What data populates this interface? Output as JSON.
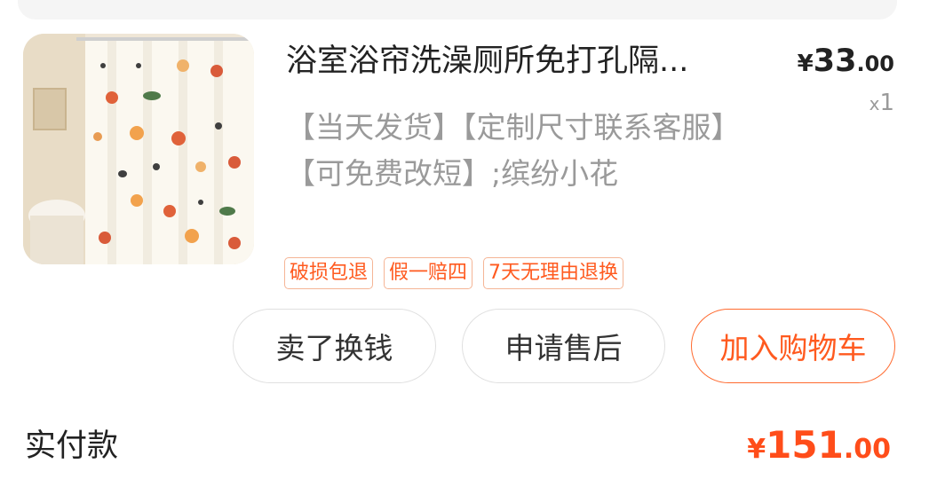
{
  "item": {
    "title": "浴室浴帘洗澡厕所免打孔隔...",
    "spec": "【当天发货】【定制尺寸联系客服】【可免费改短】;缤纷小花",
    "price": {
      "currency": "¥",
      "integer": "33",
      "decimal": ".00"
    },
    "quantity": {
      "prefix": "x",
      "value": "1"
    },
    "badges": [
      "破损包退",
      "假一赔四",
      "7天无理由退换"
    ],
    "thumbnail_icon": "shower-curtain-product-image"
  },
  "actions": {
    "sell": "卖了换钱",
    "after_sales": "申请售后",
    "add_to_cart": "加入购物车"
  },
  "summary": {
    "label": "实付款",
    "currency": "¥",
    "integer": "151",
    "decimal": ".00"
  },
  "colors": {
    "accent": "#ff5a1f",
    "price_total": "#ff4d1a",
    "badge_border": "#f5b596",
    "muted_text": "#9a9a9a"
  }
}
